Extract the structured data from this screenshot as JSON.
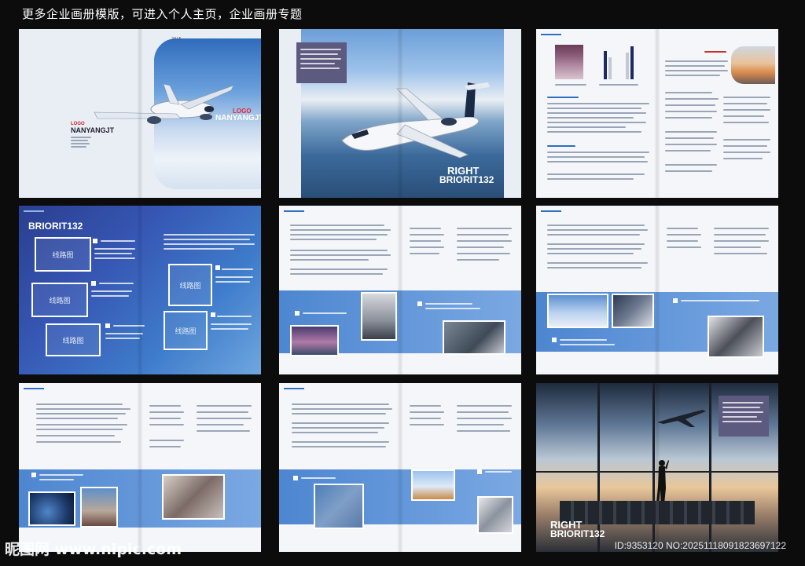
{
  "banner": {
    "text": "更多企业画册模版，可进入个人主页，企业画册专题"
  },
  "spread1": {
    "year": "2015",
    "logo": "LOGO",
    "brand": "NANYANGJT",
    "logo_left": "LOGO",
    "brand_left": "NANYANGJT"
  },
  "spread2": {
    "right": "RIGHT",
    "code": "BRIORIT132"
  },
  "spread4": {
    "title": "BRIORIT132",
    "route": "线路图"
  },
  "spread9": {
    "right": "RIGHT",
    "code": "BRIORIT132"
  },
  "watermark": {
    "site": "昵图网 www.nipic.com",
    "id": "ID:9353120 NO:20251118091823697122"
  },
  "colors": {
    "background": "#0c0c0c",
    "accent": "#2e6fc0",
    "band": "#4d86d0",
    "cover_sky": "#3d77c2"
  },
  "icons": [
    "airplane-illustration",
    "white-square-bullet"
  ]
}
